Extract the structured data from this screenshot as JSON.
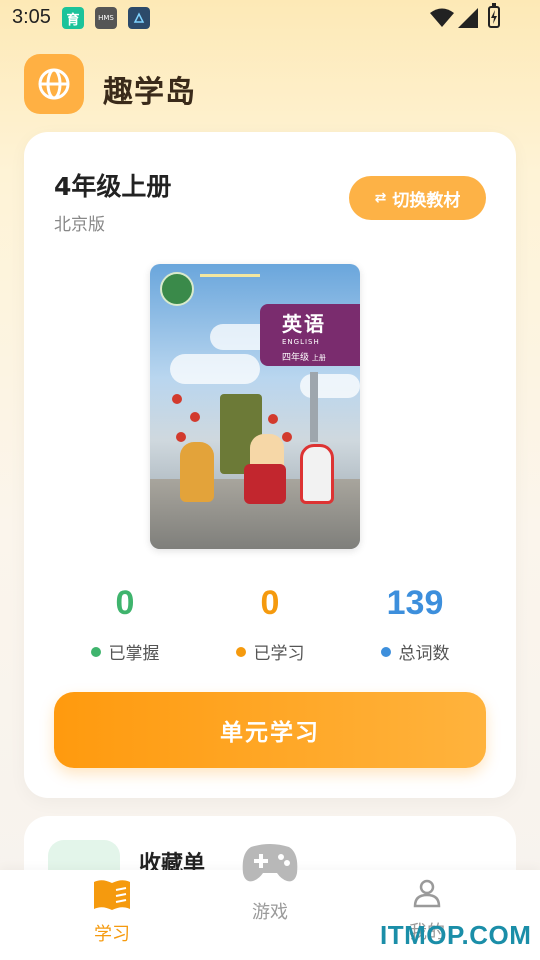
{
  "status_bar": {
    "time": "3:05",
    "apps": [
      {
        "icon": "education-app-icon",
        "label": "育"
      },
      {
        "icon": "hms-icon",
        "label": "HMS"
      },
      {
        "icon": "app-icon-3",
        "label": ""
      }
    ]
  },
  "header": {
    "title": "趣学岛",
    "logo_icon": "globe-icon"
  },
  "book": {
    "grade": "4年级上册",
    "edition": "北京版",
    "switch_label": "切换教材",
    "cover": {
      "title": "英语",
      "subtitle": "ENGLISH",
      "grade_line": "四年级",
      "term": "上册"
    }
  },
  "stats": [
    {
      "value": "0",
      "label": "已掌握",
      "color": "#3fb46d"
    },
    {
      "value": "0",
      "label": "已学习",
      "color": "#f59a0e"
    },
    {
      "value": "139",
      "label": "总词数",
      "color": "#3d8fdc"
    }
  ],
  "primary_action": {
    "label": "单元学习"
  },
  "favorites": {
    "title": "收藏单"
  },
  "nav": {
    "study": "学习",
    "games": "游戏",
    "mine": "我的",
    "active_color": "#f59a0e",
    "inactive_color": "#9a9a9a"
  },
  "watermark": "ITMOP.COM"
}
